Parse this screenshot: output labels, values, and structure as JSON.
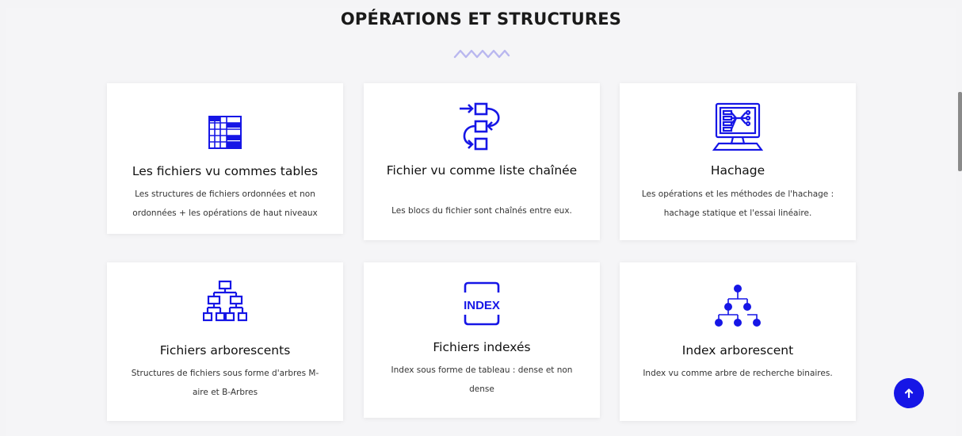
{
  "section": {
    "title": "OPÉRATIONS ET STRUCTURES"
  },
  "colors": {
    "accent": "#1616e6",
    "wave": "#b9b7ef",
    "background": "#f5f5f7",
    "card": "#ffffff"
  },
  "cards": [
    {
      "icon": "table-grid-icon",
      "title": "Les fichiers vu commes tables",
      "description": "Les structures de fichiers ordonnées et non ordonnées + les opérations de haut niveaux"
    },
    {
      "icon": "linked-list-icon",
      "title": "Fichier vu comme liste chaînée",
      "description": "Les blocs du fichier sont chaînés entre eux."
    },
    {
      "icon": "hashing-monitor-icon",
      "title": "Hachage",
      "description": "Les opérations et les méthodes de l'hachage : hachage statique et l'essai linéaire."
    },
    {
      "icon": "tree-structure-icon",
      "title": "Fichiers arborescents",
      "description": "Structures de fichiers sous forme d'arbres M-aire et B-Arbres"
    },
    {
      "icon": "index-icon",
      "title": "Fichiers indexés",
      "description": "Index sous forme de tableau : dense et non dense",
      "icon_text": "INDEX"
    },
    {
      "icon": "index-tree-icon",
      "title": "Index arborescent",
      "description": "Index vu comme arbre de recherche binaires."
    }
  ],
  "scroll_to_top": {
    "icon": "arrow-up-icon"
  }
}
